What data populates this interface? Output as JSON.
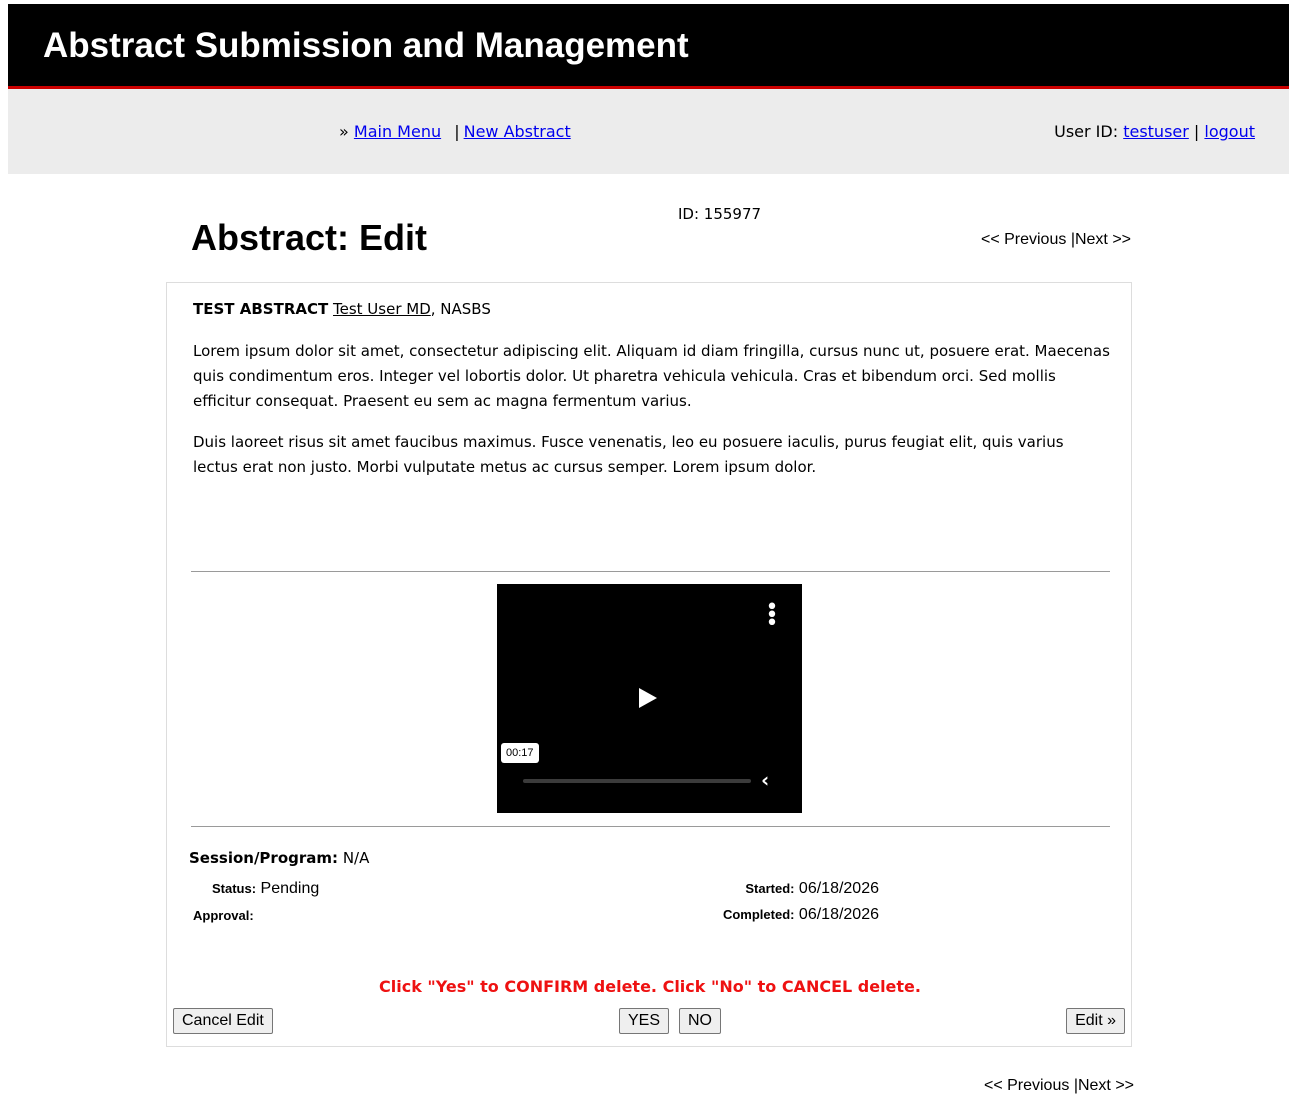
{
  "header": {
    "title": "Abstract Submission and Management"
  },
  "nav": {
    "prefix": "»",
    "main_menu": "Main Menu",
    "separator": "|",
    "new_abstract": "New Abstract",
    "user_label": "User ID:",
    "user_id": "testuser",
    "user_sep": "|",
    "logout": "logout"
  },
  "page": {
    "title": "Abstract: Edit",
    "id_text": "ID: 155977",
    "previous": "<< Previous",
    "pager_sep": "|",
    "next": "Next >>"
  },
  "abstract": {
    "title": "TEST ABSTRACT",
    "author": "Test User MD",
    "affiliation": ", NASBS",
    "paragraphs": [
      "Lorem ipsum dolor sit amet, consectetur adipiscing elit. Aliquam id diam fringilla, cursus nunc ut, posuere erat. Maecenas quis condimentum eros. Integer vel lobortis dolor. Ut pharetra vehicula vehicula. Cras et bibendum orci. Sed mollis efficitur consequat. Praesent eu sem ac magna fermentum varius.",
      "Duis laoreet risus sit amet faucibus maximus. Fusce venenatis, leo eu posuere iaculis, purus feugiat elit, quis varius lectus erat non justo. Morbi vulputate metus ac cursus semper. Lorem ipsum dolor."
    ]
  },
  "video": {
    "time": "00:17"
  },
  "details": {
    "session_label": "Session/Program:",
    "session_value": "N/A",
    "status_label": "Status:",
    "status_value": "Pending",
    "approval_label": "Approval:",
    "started_label": "Started:",
    "started_value": "06/18/2026",
    "completed_label": "Completed:",
    "completed_value": "06/18/2026"
  },
  "confirm": {
    "message": "Click \"Yes\" to CONFIRM delete. Click \"No\" to CANCEL delete.",
    "cancel_edit": "Cancel Edit",
    "yes": "YES",
    "no": "NO",
    "edit": "Edit »"
  },
  "colors": {
    "banner_bg": "#000000",
    "banner_accent": "#cc0000",
    "nav_bg": "#ececec",
    "link": "#0000ee",
    "warning": "#ee1111"
  }
}
